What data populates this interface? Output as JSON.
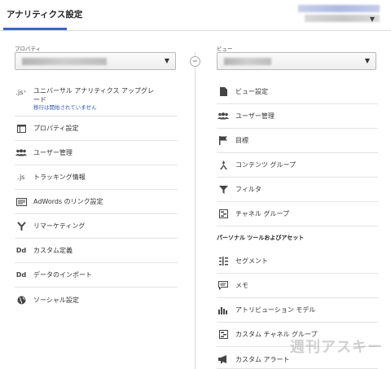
{
  "header": {
    "title": "アナリティクス設定"
  },
  "property": {
    "label": "プロパティ",
    "items": [
      {
        "icon": "js-upgrade-icon",
        "label": "ユニバーサル アナリティクス アップグレード",
        "sub": "移行は開始されていません"
      },
      {
        "icon": "window-icon",
        "label": "プロパティ設定"
      },
      {
        "icon": "users-icon",
        "label": "ユーザー管理"
      },
      {
        "icon": "js-icon",
        "label": "トラッキング情報"
      },
      {
        "icon": "adwords-icon",
        "label": "AdWords のリンク設定"
      },
      {
        "icon": "remarketing-icon",
        "label": "リマーケティング"
      },
      {
        "icon": "dd-icon",
        "label": "カスタム定義"
      },
      {
        "icon": "dd-icon",
        "label": "データのインポート"
      },
      {
        "icon": "globe-icon",
        "label": "ソーシャル設定"
      }
    ]
  },
  "view": {
    "label": "ビュー",
    "items": [
      {
        "icon": "document-icon",
        "label": "ビュー設定"
      },
      {
        "icon": "users-icon",
        "label": "ユーザー管理"
      },
      {
        "icon": "flag-icon",
        "label": "目標"
      },
      {
        "icon": "content-group-icon",
        "label": "コンテンツ グループ"
      },
      {
        "icon": "filter-icon",
        "label": "フィルタ"
      },
      {
        "icon": "channel-group-icon",
        "label": "チャネル グループ"
      }
    ],
    "personal_heading": "パーソナル ツールおよびアセット",
    "personal_items": [
      {
        "icon": "segment-icon",
        "label": "セグメント"
      },
      {
        "icon": "comment-icon",
        "label": "メモ"
      },
      {
        "icon": "bar-chart-icon",
        "label": "アトリビューション モデル"
      },
      {
        "icon": "channel-group-icon",
        "label": "カスタム チャネル グループ"
      },
      {
        "icon": "megaphone-icon",
        "label": "カスタム アラート"
      }
    ]
  },
  "watermark": "週刊アスキー",
  "colors": {
    "accent": "#3a63c4",
    "link": "#2f56b0"
  }
}
